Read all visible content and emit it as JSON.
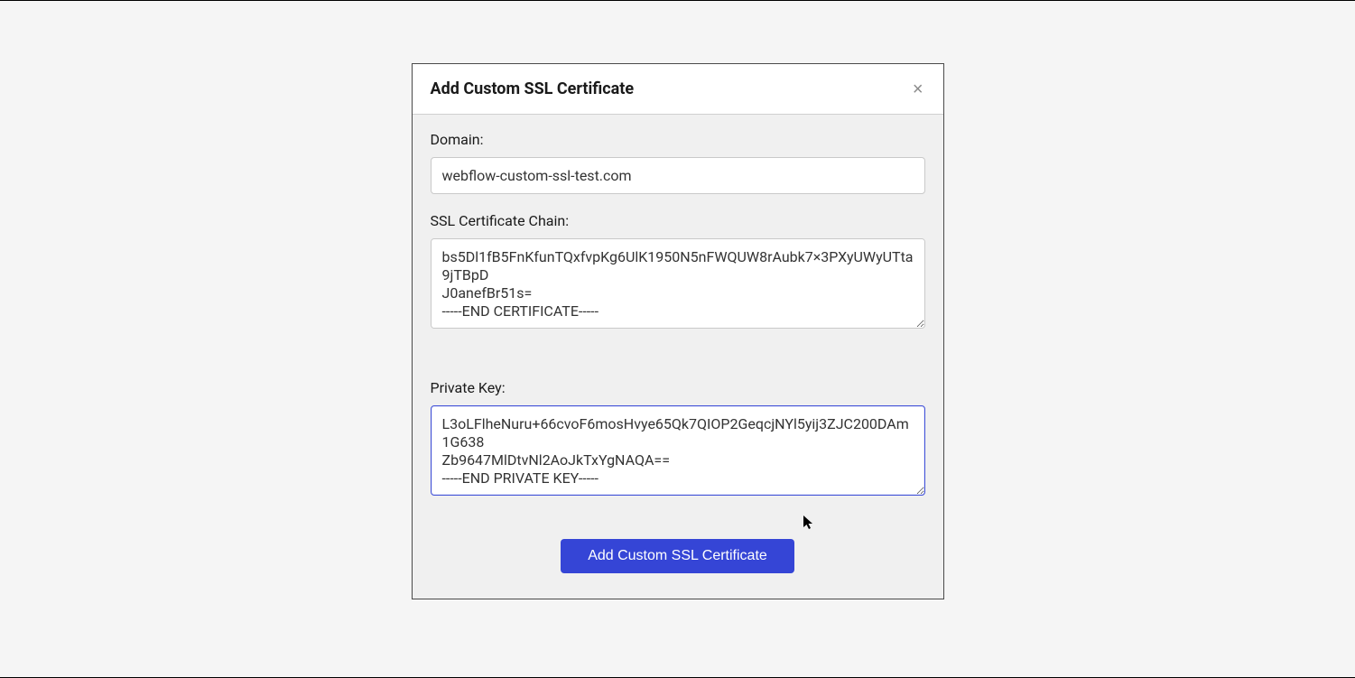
{
  "modal": {
    "title": "Add Custom SSL Certificate",
    "close_label": "×"
  },
  "form": {
    "domain": {
      "label": "Domain:",
      "value": "webflow-custom-ssl-test.com"
    },
    "chain": {
      "label": "SSL Certificate Chain:",
      "value": "bs5Dl1fB5FnKfunTQxfvpKg6UlK1950N5nFWQUW8rAubk7×3PXyUWyUTta9jTBpD\nJ0anefBr51s=\n-----END CERTIFICATE-----"
    },
    "private_key": {
      "label": "Private Key:",
      "value": "L3oLFlheNuru+66cvoF6mosHvye65Qk7QIOP2GeqcjNYl5yij3ZJC200DAm1G638\nZb9647MlDtvNl2AoJkTxYgNAQA==\n-----END PRIVATE KEY-----"
    }
  },
  "actions": {
    "submit_label": "Add Custom SSL Certificate"
  }
}
